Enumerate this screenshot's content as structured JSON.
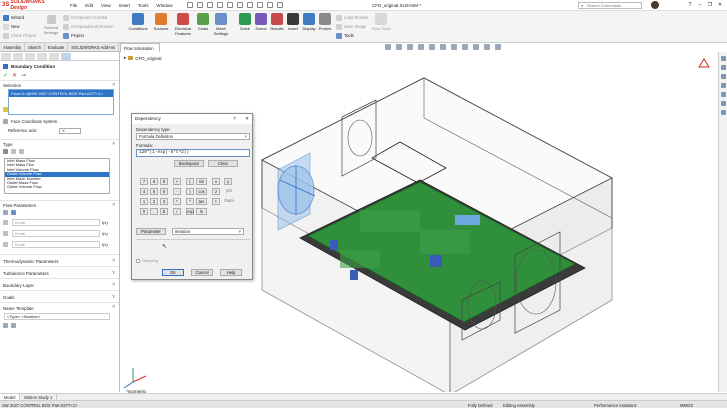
{
  "app": {
    "logo_mark": "3S",
    "logo_text": "SOLIDWORKS Design",
    "document_title": "CFD_original.SLDASM *",
    "search_placeholder": "Search Commands",
    "menus": [
      "File",
      "Edit",
      "View",
      "Insert",
      "Tools",
      "Window"
    ]
  },
  "ribbon": {
    "small_items": [
      {
        "label": "Wizard",
        "icon": "wizard-icon"
      },
      {
        "label": "New",
        "icon": "new-icon"
      },
      {
        "label": "Clone Project",
        "icon": "clone-project-icon"
      }
    ],
    "general_settings": "General Settings",
    "small_items_2": [
      {
        "label": "Component Control"
      },
      {
        "label": "Computational Domain"
      },
      {
        "label": "Project"
      }
    ],
    "big_buttons": [
      {
        "label": "Conditions",
        "color": "#3e7bc4"
      },
      {
        "label": "Sources",
        "color": "#e07a2d"
      },
      {
        "label": "Electrical Features",
        "color": "#d04a4a"
      },
      {
        "label": "Goals",
        "color": "#5aa04a"
      },
      {
        "label": "Mesh Settings",
        "color": "#6b8fc7"
      },
      {
        "label": "Solve",
        "color": "#2e9a4f"
      },
      {
        "label": "Scene",
        "color": "#7a5ab8"
      },
      {
        "label": "Results",
        "color": "#c94a4a"
      },
      {
        "label": "Insert",
        "color": "#3a3a3a"
      },
      {
        "label": "Display",
        "color": "#3e7bc4"
      },
      {
        "label": "Probes",
        "color": "#8a8a8a"
      }
    ],
    "right_items": [
      {
        "label": "Load Results"
      },
      {
        "label": "Save Image"
      },
      {
        "label": "Tools"
      }
    ],
    "flow_tools": "Flow Tools"
  },
  "command_tabs": [
    "Assembly",
    "Sketch",
    "Evaluate",
    "SOLIDWORKS Add-Ins"
  ],
  "flow_tab": "Flow Simulation",
  "property_manager": {
    "title": "Boundary Condition",
    "selection_header": "Selection",
    "selection_item": "Face<1>@SW 2027 CONTROL BOX Part-0377<1>",
    "face_coordinate_system": "Face Coordinate System",
    "reference_axis_label": "Reference axis:",
    "reference_axis_value": "X",
    "type_header": "Type",
    "type_options": [
      "Inlet Mass Flow",
      "Inlet Mass Flux",
      "Inlet Volume Flow",
      "Outlet Volume Flow",
      "Inlet Mach Number",
      "Outlet Mass Flow",
      "Outlet Volume Flow"
    ],
    "type_selected_index": 3,
    "flow_params_header": "Flow Parameters",
    "flow_values": [
      "0 m/s",
      "0 m/s",
      "0 m/s"
    ],
    "sections": [
      "Thermodynamic Parameters",
      "Turbulence Parameters",
      "Boundary Layer",
      "Goals"
    ],
    "name_template_header": "Name Template",
    "name_template_value": "<Type> <Number>"
  },
  "tree": {
    "root": "CFD_original"
  },
  "dialog": {
    "title": "Dependency",
    "help": "?",
    "close": "✕",
    "dependency_type_label": "Dependency type:",
    "dependency_type_value": "Formula Definition",
    "formula_label": "Formula:",
    "formula_value": "120*(1-exp(-5*t^2))",
    "backspace": "Backspace",
    "clear": "Clear",
    "keys": [
      [
        "7",
        "8",
        "9",
        "+",
        "(",
        "sin",
        "x",
        "y"
      ],
      [
        "4",
        "5",
        "6",
        "-",
        ")",
        "cos",
        "z",
        "phi"
      ],
      [
        "1",
        "2",
        "3",
        "*",
        "^",
        "tan",
        "t",
        "theta"
      ],
      [
        "0",
        ".",
        "E",
        "/",
        "exp",
        "ln",
        "",
        ""
      ]
    ],
    "parameter_button": "Parameter",
    "parameter_value": "Iteration",
    "damping": "Damping",
    "ok": "OK",
    "cancel": "Cancel",
    "help_button": "Help"
  },
  "view": {
    "orientation": "*Isometric"
  },
  "bottom_tabs": [
    "Model",
    "Motion Study 1"
  ],
  "status": {
    "part": "SW 2027 CONTROL BOX Part-0377<1>",
    "defined": "Fully Defined",
    "mode": "Editing Assembly",
    "assistant": "Performance Assistant:",
    "units": "MMGS"
  },
  "colors": {
    "accent": "#2f73c9",
    "brand": "#d52b1e",
    "pcb": "#2f8f3a",
    "bc_face": "#9dc3ea"
  }
}
